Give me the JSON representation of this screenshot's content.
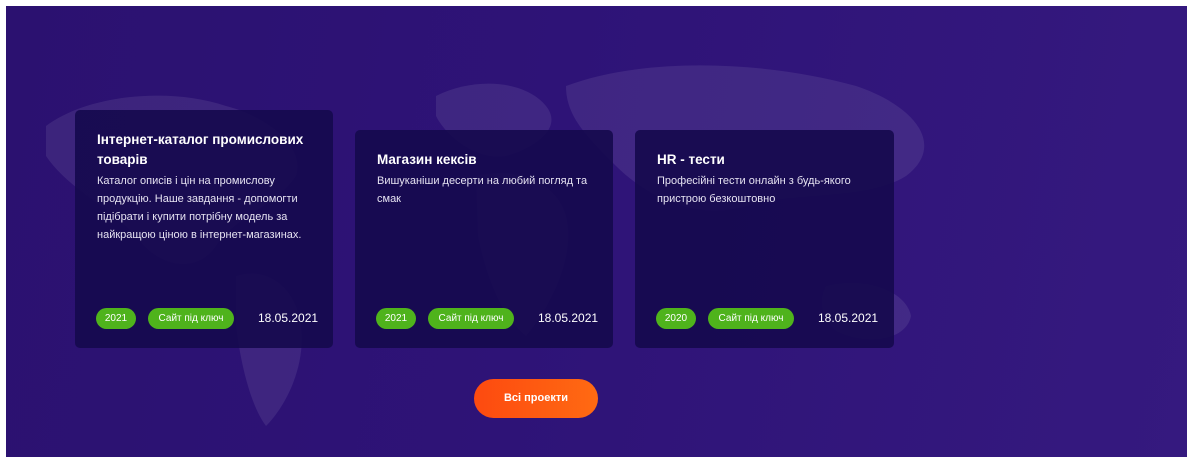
{
  "projects": [
    {
      "title_line1": "Інтернет-каталог промислових",
      "title_line2": "товарів",
      "desc_lines": [
        "Каталог описів і цін на промислову",
        "продукцію. Наше завдання - допомогти",
        "підібрати і купити потрібну модель за",
        "найкращою ціною в інтернет-магазинах."
      ],
      "year": "2021",
      "type": "Сайт під ключ",
      "date": "18.05.2021"
    },
    {
      "title_line1": "Магазин кексів",
      "desc_lines": [
        "Вишуканіши десерти на любий погляд та",
        "смак"
      ],
      "year": "2021",
      "type": "Сайт під ключ",
      "date": "18.05.2021"
    },
    {
      "title_line1": "HR - тести",
      "desc_lines": [
        "Професійні тести онлайн з будь-якого",
        "пристрою безкоштовно"
      ],
      "year": "2020",
      "type": "Сайт під ключ",
      "date": "18.05.2021"
    }
  ],
  "all_projects_label": "Всі проекти",
  "colors": {
    "background": "#2e1377",
    "card": "#160a4e",
    "tag": "#4fb31c",
    "button": "#fd4a10"
  }
}
